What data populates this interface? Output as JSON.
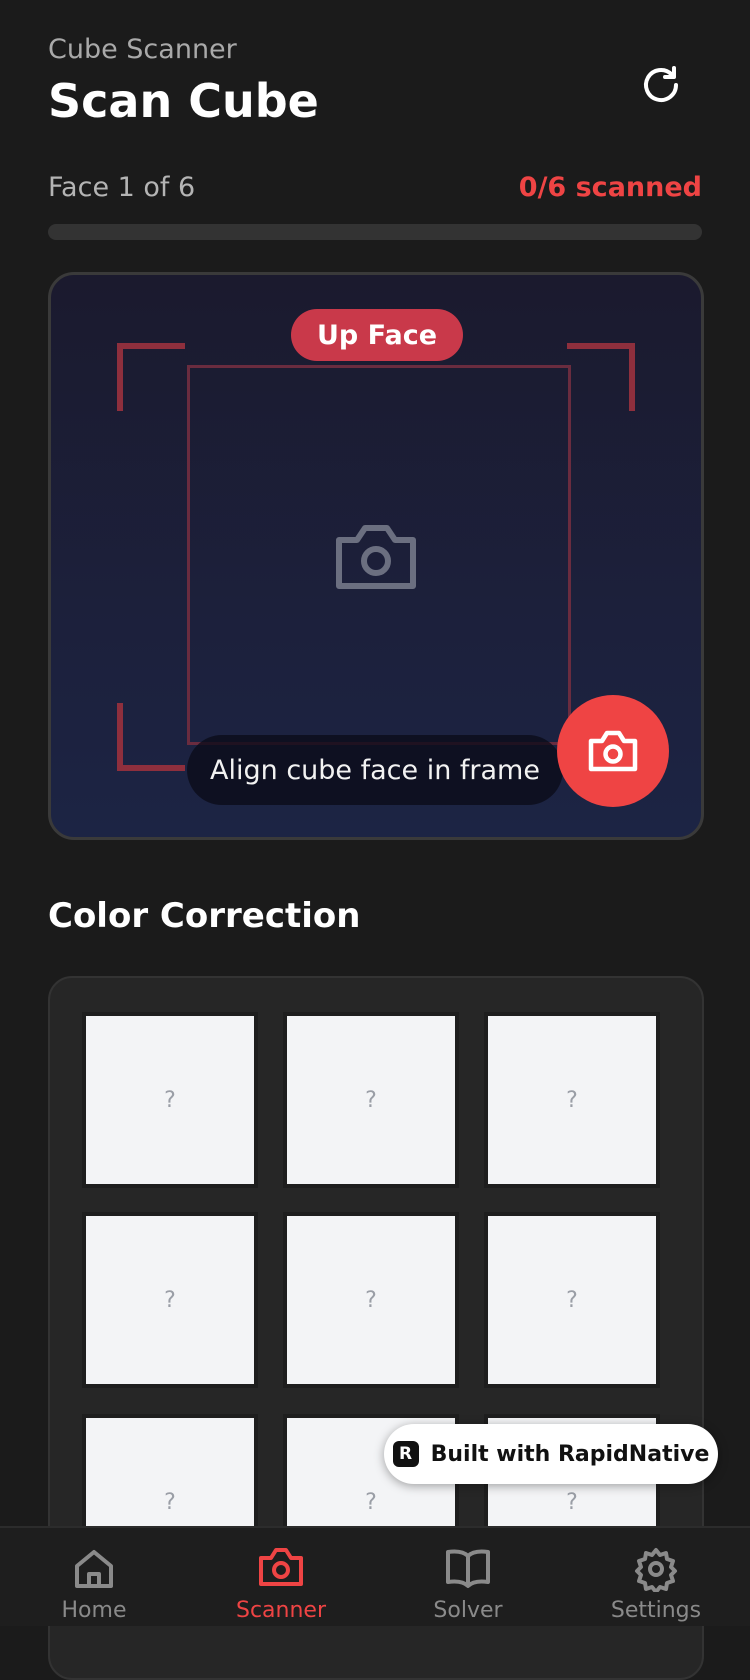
{
  "header": {
    "app_name": "Cube Scanner",
    "title": "Scan Cube",
    "refresh_icon": "refresh-icon"
  },
  "progress": {
    "face_label": "Face 1 of 6",
    "scanned_label": "0/6 scanned",
    "scanned": 0,
    "total": 6,
    "accent_color": "#ef4444"
  },
  "scanner": {
    "face_badge": "Up Face",
    "hint": "Align cube face in frame",
    "center_icon": "camera-icon",
    "capture_icon": "camera-icon",
    "capture_color": "#ef4444"
  },
  "color_correction": {
    "title": "Color Correction",
    "stickers": [
      "?",
      "?",
      "?",
      "?",
      "?",
      "?",
      "?",
      "?",
      "?"
    ]
  },
  "badge": {
    "logo": "R",
    "text": "Built with RapidNative"
  },
  "tabs": [
    {
      "label": "Home",
      "icon": "home-icon",
      "active": false
    },
    {
      "label": "Scanner",
      "icon": "camera-icon",
      "active": true
    },
    {
      "label": "Solver",
      "icon": "book-icon",
      "active": false
    },
    {
      "label": "Settings",
      "icon": "gear-icon",
      "active": false
    }
  ],
  "colors": {
    "background": "#1b1b1b",
    "active_tab": "#ef4444",
    "inactive_tab": "#8a8a8a"
  }
}
